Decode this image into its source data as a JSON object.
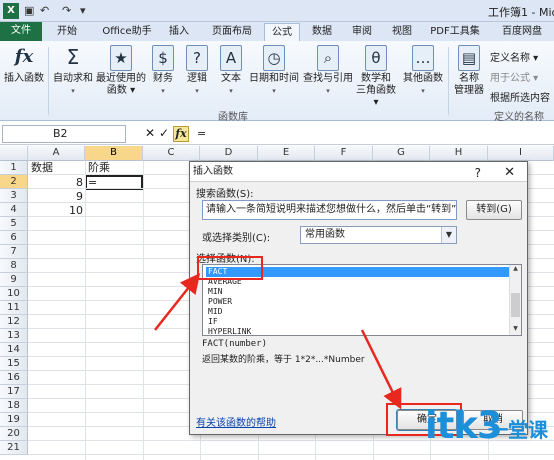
{
  "window": {
    "title": "工作簿1 - Mic",
    "app_icon": "X"
  },
  "qat": {
    "undo": "↶",
    "redo": "↷",
    "customize": "▾"
  },
  "tabs": [
    "文件",
    "开始",
    "Office助手",
    "插入",
    "页面布局",
    "公式",
    "数据",
    "审阅",
    "视图",
    "PDF工具集",
    "百度网盘"
  ],
  "ribbon": {
    "buttons": [
      {
        "label1": "插入函数",
        "label2": "",
        "icon": "fx-icon",
        "glyph": "fx"
      },
      {
        "label1": "自动求和",
        "label2": "▾",
        "icon": "sigma-icon",
        "glyph": "Σ"
      },
      {
        "label1": "最近使用的",
        "label2": "函数 ▾",
        "icon": "recent-book-icon",
        "glyph": "★"
      },
      {
        "label1": "财务",
        "label2": "▾",
        "icon": "finance-book-icon",
        "glyph": "$"
      },
      {
        "label1": "逻辑",
        "label2": "▾",
        "icon": "logic-book-icon",
        "glyph": "?"
      },
      {
        "label1": "文本",
        "label2": "▾",
        "icon": "text-book-icon",
        "glyph": "A"
      },
      {
        "label1": "日期和时间",
        "label2": "▾",
        "icon": "datetime-book-icon",
        "glyph": "◷"
      },
      {
        "label1": "查找与引用",
        "label2": "▾",
        "icon": "lookup-book-icon",
        "glyph": "⌕"
      },
      {
        "label1": "数学和",
        "label2": "三角函数 ▾",
        "icon": "math-book-icon",
        "glyph": "θ"
      },
      {
        "label1": "其他函数",
        "label2": "▾",
        "icon": "more-book-icon",
        "glyph": "…"
      },
      {
        "label1": "名称",
        "label2": "管理器",
        "icon": "name-manager-icon",
        "glyph": "▤"
      }
    ],
    "group_library": "函数库",
    "group_names": "定义的名称",
    "define_name": "定义名称 ▾",
    "use_in_formula": "用于公式 ▾",
    "create_from_selection": "根据所选内容"
  },
  "formula_bar": {
    "name_box": "B2",
    "cancel": "✕",
    "enter": "✓",
    "fx": "fx",
    "content": "="
  },
  "sheet": {
    "columns": [
      "A",
      "B",
      "C",
      "D",
      "E",
      "F",
      "G",
      "H",
      "I"
    ],
    "rows": [
      "1",
      "2",
      "3",
      "4",
      "5",
      "6",
      "7",
      "8",
      "9",
      "10",
      "11",
      "12",
      "13",
      "14",
      "15",
      "16",
      "17",
      "18",
      "19",
      "20",
      "21"
    ],
    "a1": "数据",
    "b1": "阶乘",
    "a2": "8",
    "a3": "9",
    "a4": "10",
    "b2": "="
  },
  "dialog": {
    "title": "插入函数",
    "help": "?",
    "close": "✕",
    "search_label": "搜索函数(S):",
    "search_text": "请输入一条简短说明来描述您想做什么，然后单击“转到”",
    "go_button": "转到(G)",
    "category_label": "或选择类别(C):",
    "category_value": "常用函数",
    "select_label": "选择函数(N):",
    "functions": [
      "FACT",
      "AVERAGE",
      "MIN",
      "POWER",
      "MID",
      "IF",
      "HYPERLINK"
    ],
    "selected_function": "FACT",
    "syntax": "FACT(number)",
    "description": "返回某数的阶乘，等于 1*2*...*Number",
    "help_link": "有关该函数的帮助",
    "ok_button": "确定",
    "cancel_button": "取消"
  },
  "watermark": {
    "text": "itk3",
    "suffix": "一堂课"
  },
  "colors": {
    "excel_green": "#1e7145",
    "highlight_red": "#e8271f",
    "selection_blue": "#3399ff"
  }
}
